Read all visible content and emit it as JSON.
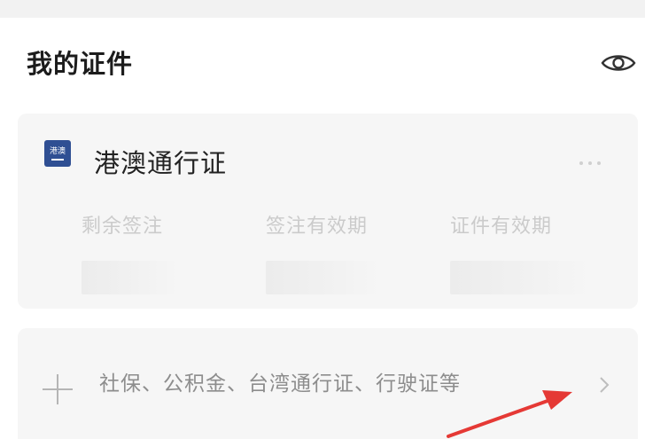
{
  "section": {
    "title": "我的证件",
    "eye_icon": "eye-icon"
  },
  "pass_card": {
    "badge_text": "港澳",
    "title": "港澳通行证",
    "more_icon": "more-dots-icon",
    "fields": [
      {
        "label": "剩余签注"
      },
      {
        "label": "签注有效期"
      },
      {
        "label": "证件有效期"
      }
    ]
  },
  "add_card": {
    "icon": "plus-icon",
    "label": "社保、公积金、台湾通行证、行驶证等",
    "chevron_icon": "chevron-right-icon"
  },
  "annotation": {
    "arrow_color": "#e53935"
  }
}
